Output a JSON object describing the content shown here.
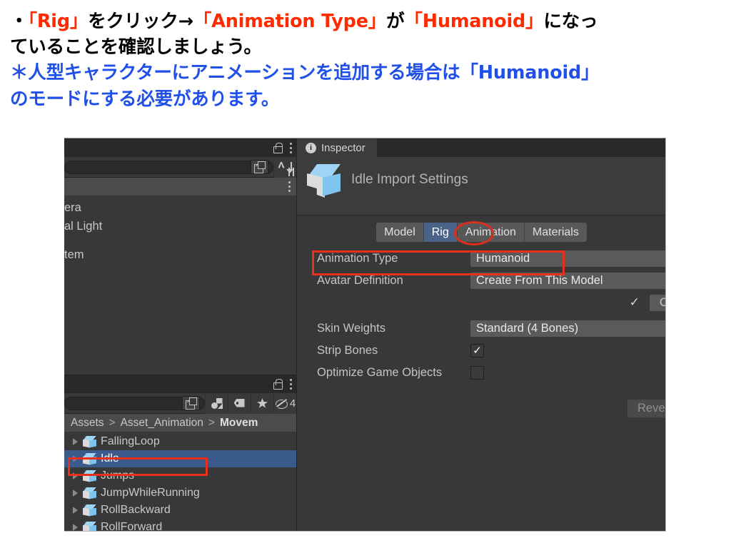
{
  "caption": {
    "line1_a": "・",
    "line1_rig": "「Rig」",
    "line1_b": "をクリック→",
    "line1_anim": "「Animation Type」",
    "line1_c": "が",
    "line1_hum": "「Humanoid」",
    "line1_d": "になっ",
    "line2": "ていることを確認しましょう。",
    "line3": "＊人型キャラクターにアニメーションを追加する場合は「Humanoid」",
    "line4": "のモードにする必要があります。",
    "colors": {
      "red": "#FF2B00",
      "blue": "#2050E8",
      "black": "#000000"
    }
  },
  "hierarchy": {
    "tab_tools": {
      "lock": "lock-icon",
      "menu": "kebab-menu-icon"
    },
    "toolbar": {
      "search_value": "",
      "picker": "object-picker-icon",
      "sort": "sort-alphabetical-icon"
    },
    "breadcrumb_menu": "kebab-menu-icon",
    "items": [
      {
        "label": "era"
      },
      {
        "label": "al Light"
      },
      {
        "label": "tem"
      }
    ]
  },
  "project": {
    "tab_tools": {
      "lock": "lock-icon",
      "menu": "kebab-menu-icon"
    },
    "toolbar": {
      "search_value": "",
      "picker": "object-picker-icon",
      "avatar_filter": "avatar-filter-icon",
      "label_filter": "tag-icon",
      "favorite_filter": "star-icon",
      "hidden_filter": "eye-off-icon",
      "hidden_count": "4"
    },
    "breadcrumb": {
      "root": "Assets",
      "mid": "Asset_Animation",
      "current": "Movem",
      "separator": ">"
    },
    "assets": [
      {
        "label": "FallingLoop",
        "selected": false
      },
      {
        "label": "Idle",
        "selected": true
      },
      {
        "label": "Jumps",
        "selected": false
      },
      {
        "label": "JumpWhileRunning",
        "selected": false
      },
      {
        "label": "RollBackward",
        "selected": false
      },
      {
        "label": "RollForward",
        "selected": false
      }
    ]
  },
  "inspector": {
    "tab_label": "Inspector",
    "title": "Idle Import Settings",
    "tabs": [
      {
        "label": "Model",
        "active": false
      },
      {
        "label": "Rig",
        "active": true
      },
      {
        "label": "Animation",
        "active": false
      },
      {
        "label": "Materials",
        "active": false
      }
    ],
    "properties": {
      "animation_type_label": "Animation Type",
      "animation_type_value": "Humanoid",
      "avatar_definition_label": "Avatar Definition",
      "avatar_definition_value": "Create From This Model",
      "configure_check": "✓",
      "configure_button": "Co",
      "skin_weights_label": "Skin Weights",
      "skin_weights_value": "Standard (4 Bones)",
      "strip_bones_label": "Strip Bones",
      "strip_bones_checked": "✓",
      "optimize_label": "Optimize Game Objects",
      "optimize_checked": ""
    },
    "revert_button": "Rever"
  },
  "annotations": {
    "rect_animation_type": "red-rectangle-animation-type",
    "rect_idle_asset": "red-rectangle-idle-asset",
    "ellipse_rig_tab": "red-ellipse-rig-tab",
    "color": "#E8301C"
  }
}
